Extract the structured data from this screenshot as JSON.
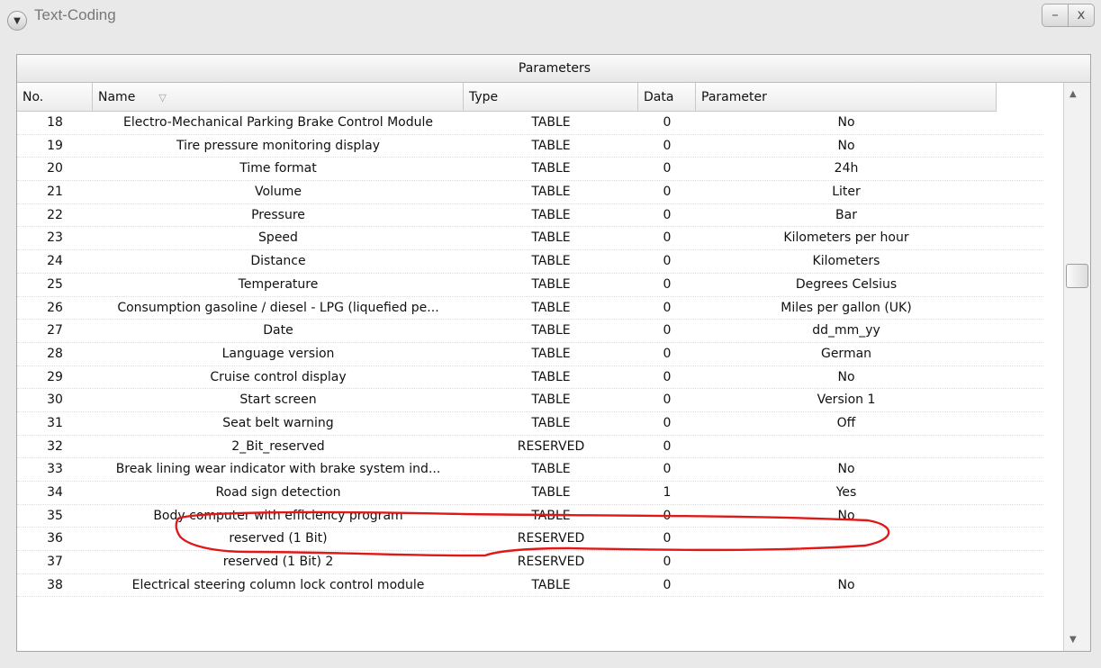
{
  "window": {
    "title": "Text-Coding",
    "menu_icon": "chevron-down-icon",
    "minimize_label": "–",
    "close_label": "x"
  },
  "table": {
    "header": "Parameters",
    "columns": [
      "No.",
      "Name",
      "Type",
      "Data",
      "Parameter"
    ],
    "sort_icon": "▽",
    "rows": [
      {
        "no": "18",
        "name": "Electro-Mechanical Parking Brake Control Module",
        "type": "TABLE",
        "data": "0",
        "parameter": "No"
      },
      {
        "no": "19",
        "name": "Tire pressure monitoring display",
        "type": "TABLE",
        "data": "0",
        "parameter": "No"
      },
      {
        "no": "20",
        "name": "Time format",
        "type": "TABLE",
        "data": "0",
        "parameter": "24h"
      },
      {
        "no": "21",
        "name": "Volume",
        "type": "TABLE",
        "data": "0",
        "parameter": "Liter"
      },
      {
        "no": "22",
        "name": "Pressure",
        "type": "TABLE",
        "data": "0",
        "parameter": "Bar"
      },
      {
        "no": "23",
        "name": "Speed",
        "type": "TABLE",
        "data": "0",
        "parameter": "Kilometers per hour"
      },
      {
        "no": "24",
        "name": "Distance",
        "type": "TABLE",
        "data": "0",
        "parameter": "Kilometers"
      },
      {
        "no": "25",
        "name": "Temperature",
        "type": "TABLE",
        "data": "0",
        "parameter": "Degrees Celsius"
      },
      {
        "no": "26",
        "name": "Consumption gasoline / diesel - LPG (liquefied pe...",
        "type": "TABLE",
        "data": "0",
        "parameter": "Miles per gallon (UK)"
      },
      {
        "no": "27",
        "name": "Date",
        "type": "TABLE",
        "data": "0",
        "parameter": "dd_mm_yy"
      },
      {
        "no": "28",
        "name": "Language version",
        "type": "TABLE",
        "data": "0",
        "parameter": "German"
      },
      {
        "no": "29",
        "name": "Cruise control display",
        "type": "TABLE",
        "data": "0",
        "parameter": "No"
      },
      {
        "no": "30",
        "name": "Start screen",
        "type": "TABLE",
        "data": "0",
        "parameter": "Version 1"
      },
      {
        "no": "31",
        "name": "Seat belt warning",
        "type": "TABLE",
        "data": "0",
        "parameter": "Off"
      },
      {
        "no": "32",
        "name": "2_Bit_reserved",
        "type": "RESERVED",
        "data": "0",
        "parameter": ""
      },
      {
        "no": "33",
        "name": "Break lining wear indicator with brake system ind...",
        "type": "TABLE",
        "data": "0",
        "parameter": "No"
      },
      {
        "no": "34",
        "name": "Road sign detection",
        "type": "TABLE",
        "data": "1",
        "parameter": "Yes"
      },
      {
        "no": "35",
        "name": "Body computer with efficiency program",
        "type": "TABLE",
        "data": "0",
        "parameter": "No"
      },
      {
        "no": "36",
        "name": "reserved (1 Bit)",
        "type": "RESERVED",
        "data": "0",
        "parameter": ""
      },
      {
        "no": "37",
        "name": "reserved (1 Bit) 2",
        "type": "RESERVED",
        "data": "0",
        "parameter": ""
      },
      {
        "no": "38",
        "name": "Electrical steering column lock control module",
        "type": "TABLE",
        "data": "0",
        "parameter": "No"
      }
    ]
  },
  "scrollbar": {
    "up_icon": "▲",
    "down_icon": "▼"
  }
}
